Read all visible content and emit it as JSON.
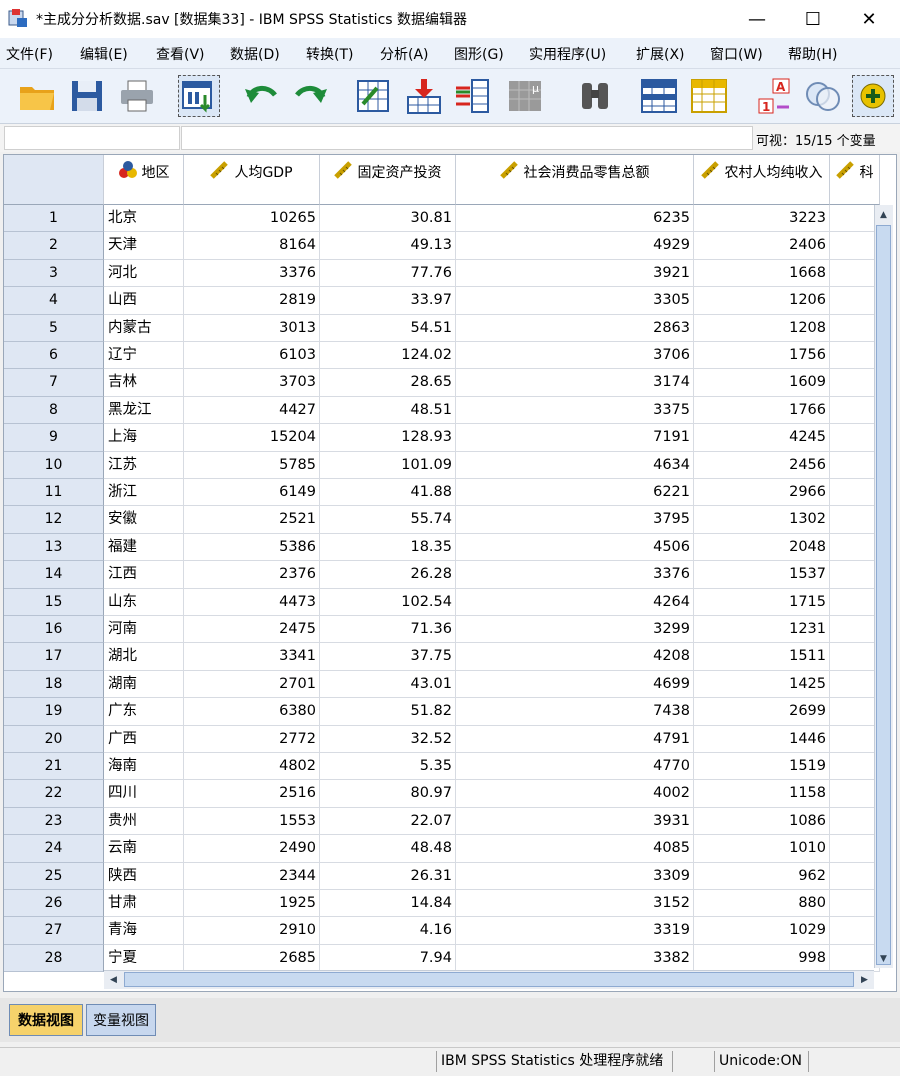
{
  "window": {
    "title": "*主成分分析数据.sav [数据集33] - IBM SPSS Statistics 数据编辑器",
    "controls": {
      "minimize": "—",
      "maximize": "☐",
      "close": "✕"
    }
  },
  "menu": [
    "文件(F)",
    "编辑(E)",
    "查看(V)",
    "数据(D)",
    "转换(T)",
    "分析(A)",
    "图形(G)",
    "实用程序(U)",
    "扩展(X)",
    "窗口(W)",
    "帮助(H)"
  ],
  "toolbar": {
    "icons": [
      "open-folder-icon",
      "save-disk-icon",
      "print-icon",
      "recall-dialog-icon",
      "undo-icon",
      "redo-icon",
      "goto-case-icon",
      "goto-variable-icon",
      "variables-icon",
      "run-descriptives-icon",
      "find-binoculars-icon",
      "insert-cases-icon",
      "insert-variable-icon",
      "split-file-icon",
      "value-labels-icon",
      "use-sets-icon",
      "add-icon"
    ]
  },
  "cellbar": {
    "reference": "",
    "value": "",
    "visible_label": "可视：15/15 个变量"
  },
  "columns": [
    {
      "label": "地区",
      "type": "nominal"
    },
    {
      "label": "人均GDP",
      "type": "scale"
    },
    {
      "label": "固定资产投资",
      "type": "scale"
    },
    {
      "label": "社会消费品零售总额",
      "type": "scale"
    },
    {
      "label": "农村人均纯收入",
      "type": "scale"
    },
    {
      "label": "科",
      "type": "scale"
    }
  ],
  "rows": [
    [
      "1",
      "北京",
      "10265",
      "30.81",
      "6235",
      "3223"
    ],
    [
      "2",
      "天津",
      "8164",
      "49.13",
      "4929",
      "2406"
    ],
    [
      "3",
      "河北",
      "3376",
      "77.76",
      "3921",
      "1668"
    ],
    [
      "4",
      "山西",
      "2819",
      "33.97",
      "3305",
      "1206"
    ],
    [
      "5",
      "内蒙古",
      "3013",
      "54.51",
      "2863",
      "1208"
    ],
    [
      "6",
      "辽宁",
      "6103",
      "124.02",
      "3706",
      "1756"
    ],
    [
      "7",
      "吉林",
      "3703",
      "28.65",
      "3174",
      "1609"
    ],
    [
      "8",
      "黑龙江",
      "4427",
      "48.51",
      "3375",
      "1766"
    ],
    [
      "9",
      "上海",
      "15204",
      "128.93",
      "7191",
      "4245"
    ],
    [
      "10",
      "江苏",
      "5785",
      "101.09",
      "4634",
      "2456"
    ],
    [
      "11",
      "浙江",
      "6149",
      "41.88",
      "6221",
      "2966"
    ],
    [
      "12",
      "安徽",
      "2521",
      "55.74",
      "3795",
      "1302"
    ],
    [
      "13",
      "福建",
      "5386",
      "18.35",
      "4506",
      "2048"
    ],
    [
      "14",
      "江西",
      "2376",
      "26.28",
      "3376",
      "1537"
    ],
    [
      "15",
      "山东",
      "4473",
      "102.54",
      "4264",
      "1715"
    ],
    [
      "16",
      "河南",
      "2475",
      "71.36",
      "3299",
      "1231"
    ],
    [
      "17",
      "湖北",
      "3341",
      "37.75",
      "4208",
      "1511"
    ],
    [
      "18",
      "湖南",
      "2701",
      "43.01",
      "4699",
      "1425"
    ],
    [
      "19",
      "广东",
      "6380",
      "51.82",
      "7438",
      "2699"
    ],
    [
      "20",
      "广西",
      "2772",
      "32.52",
      "4791",
      "1446"
    ],
    [
      "21",
      "海南",
      "4802",
      "5.35",
      "4770",
      "1519"
    ],
    [
      "22",
      "四川",
      "2516",
      "80.97",
      "4002",
      "1158"
    ],
    [
      "23",
      "贵州",
      "1553",
      "22.07",
      "3931",
      "1086"
    ],
    [
      "24",
      "云南",
      "2490",
      "48.48",
      "4085",
      "1010"
    ],
    [
      "25",
      "陕西",
      "2344",
      "26.31",
      "3309",
      "962"
    ],
    [
      "26",
      "甘肃",
      "1925",
      "14.84",
      "3152",
      "880"
    ],
    [
      "27",
      "青海",
      "2910",
      "4.16",
      "3319",
      "1029"
    ],
    [
      "28",
      "宁夏",
      "2685",
      "7.94",
      "3382",
      "998"
    ]
  ],
  "tabs": {
    "data_view": "数据视图",
    "variable_view": "变量视图"
  },
  "status": {
    "processor": "IBM SPSS Statistics 处理程序就绪",
    "unicode": "Unicode:ON"
  }
}
